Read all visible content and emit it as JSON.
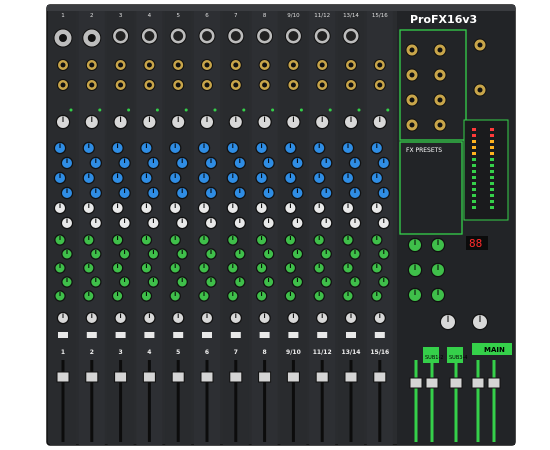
{
  "brand": {
    "logo_text": "ProFX16v3"
  },
  "channels": [
    {
      "top_label": "1",
      "bottom_label": "1",
      "input": "xlr-combo"
    },
    {
      "top_label": "2",
      "bottom_label": "2",
      "input": "xlr-combo"
    },
    {
      "top_label": "3",
      "bottom_label": "3",
      "input": "xlr"
    },
    {
      "top_label": "4",
      "bottom_label": "4",
      "input": "xlr"
    },
    {
      "top_label": "5",
      "bottom_label": "5",
      "input": "xlr"
    },
    {
      "top_label": "6",
      "bottom_label": "6",
      "input": "xlr"
    },
    {
      "top_label": "7",
      "bottom_label": "7",
      "input": "xlr"
    },
    {
      "top_label": "8",
      "bottom_label": "8",
      "input": "xlr"
    },
    {
      "top_label": "9/10",
      "bottom_label": "9/10",
      "input": "xlr"
    },
    {
      "top_label": "11/12",
      "bottom_label": "11/12",
      "input": "xlr"
    },
    {
      "top_label": "13/14",
      "bottom_label": "13/14",
      "input": "xlr"
    },
    {
      "top_label": "15/16",
      "bottom_label": "15/16",
      "input": "none"
    }
  ],
  "master": {
    "fx_display": "88",
    "fx_presets_title": "FX PRESETS",
    "bus_labels": [
      "SUB1-2",
      "SUB3-4",
      "MAIN"
    ]
  },
  "colors": {
    "body": "#26282b",
    "panel": "#1c1d1f",
    "accent_green": "#35d04a",
    "knob_blue": "#2f8de4",
    "knob_white": "#e9e9e9",
    "knob_green": "#3fbf4a",
    "display_red": "#ff2b2b"
  }
}
